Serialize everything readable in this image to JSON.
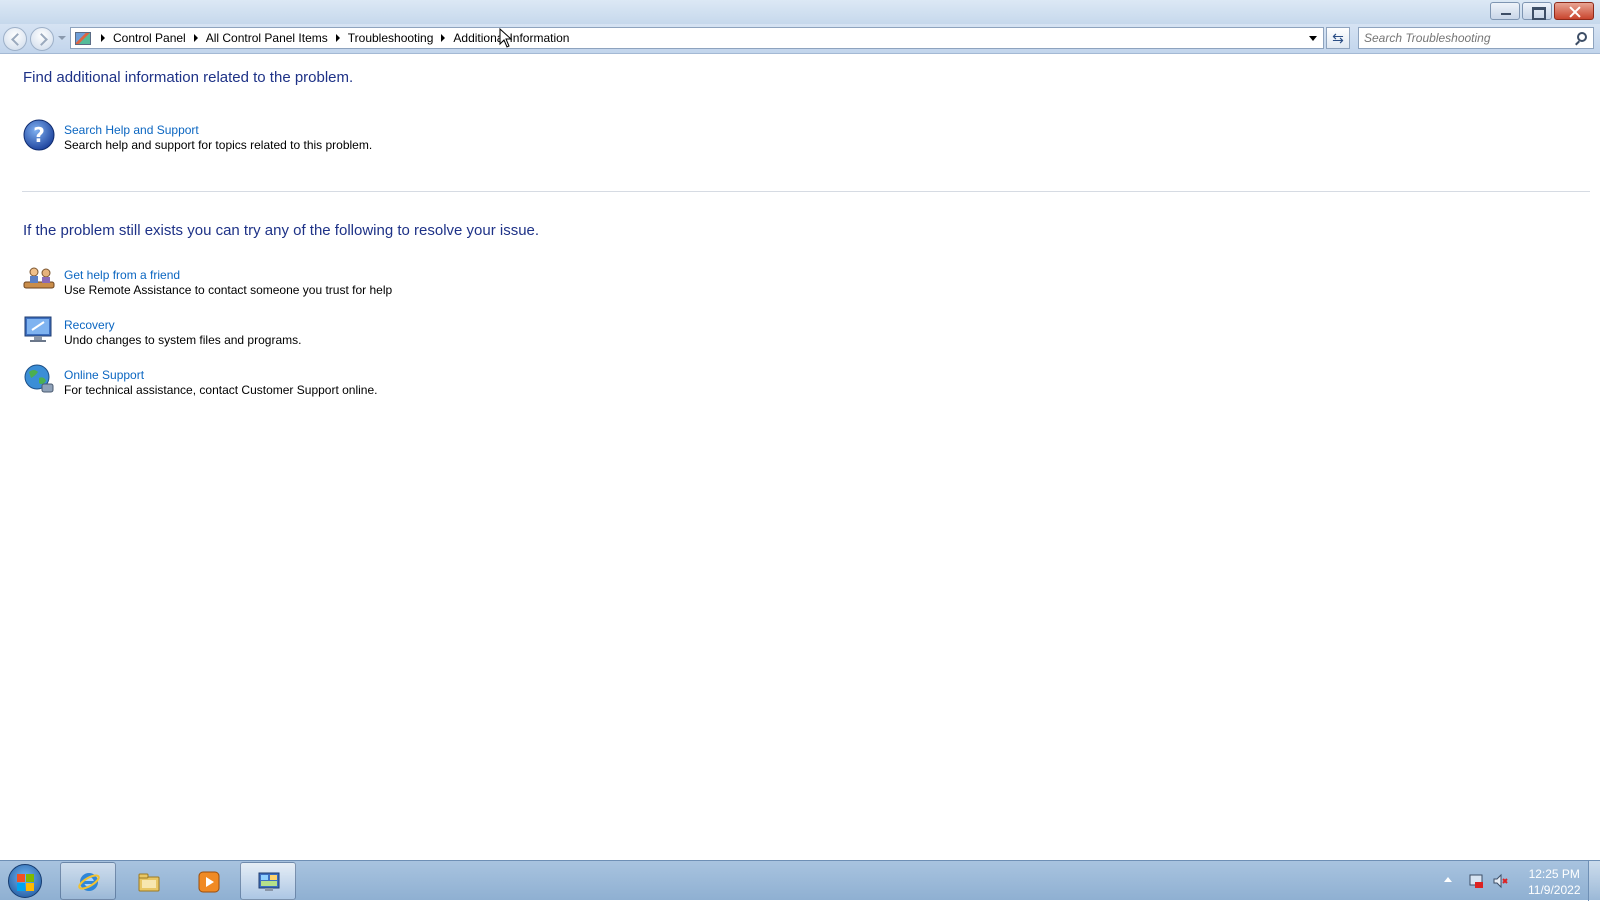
{
  "window": {
    "controls": {
      "minimize_icon": "minimize-icon",
      "maximize_icon": "restore-icon",
      "close_icon": "close-icon"
    }
  },
  "nav": {
    "breadcrumb": [
      "Control Panel",
      "All Control Panel Items",
      "Troubleshooting",
      "Additional Information"
    ],
    "search_placeholder": "Search Troubleshooting"
  },
  "main": {
    "heading1": "Find additional information related to the problem.",
    "task_search": {
      "link": "Search Help and Support",
      "desc": "Search help and support for topics related to this problem.",
      "icon": "help-question-icon"
    },
    "heading2": "If the problem still exists you can try any of the following to resolve your issue.",
    "task_friend": {
      "link": "Get help from a friend",
      "desc": "Use Remote Assistance to contact someone you trust for help",
      "icon": "remote-assistance-icon"
    },
    "task_recovery": {
      "link": "Recovery",
      "desc": "Undo changes to system files and programs.",
      "icon": "recovery-icon"
    },
    "task_online": {
      "link": "Online Support",
      "desc": "For technical assistance, contact Customer Support online.",
      "icon": "online-support-globe-icon"
    }
  },
  "taskbar": {
    "apps": [
      "internet-explorer-icon",
      "windows-explorer-icon",
      "media-player-icon",
      "control-panel-icon"
    ],
    "clock_time": "12:25 PM",
    "clock_date": "11/9/2022"
  },
  "colors": {
    "heading": "#1e3287",
    "link": "#0b66c1",
    "taskbar": "#8fb0d2"
  }
}
